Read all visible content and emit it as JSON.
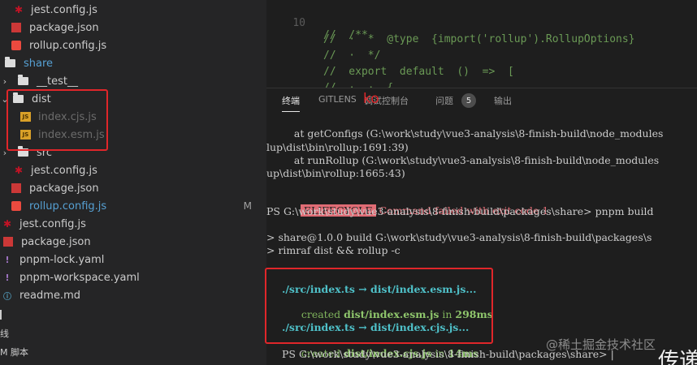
{
  "explorer": {
    "items": [
      {
        "label": "jest.config.js",
        "icon": "jest"
      },
      {
        "label": "package.json",
        "icon": "npm"
      },
      {
        "label": "rollup.config.js",
        "icon": "rollup"
      },
      {
        "label": "share",
        "icon": "folder"
      },
      {
        "label": "__test__",
        "icon": "folder"
      },
      {
        "label": "dist",
        "icon": "folder"
      },
      {
        "label": "index.cjs.js",
        "icon": "js"
      },
      {
        "label": "index.esm.js",
        "icon": "js"
      },
      {
        "label": "src",
        "icon": "folder"
      },
      {
        "label": "jest.config.js",
        "icon": "jest"
      },
      {
        "label": "package.json",
        "icon": "npm"
      },
      {
        "label": "rollup.config.js",
        "icon": "rollup",
        "badge": "M"
      },
      {
        "label": "jest.config.js",
        "icon": "jest"
      },
      {
        "label": "package.json",
        "icon": "npm"
      },
      {
        "label": "pnpm-lock.yaml",
        "icon": "yaml"
      },
      {
        "label": "pnpm-workspace.yaml",
        "icon": "yaml"
      },
      {
        "label": "readme.md",
        "icon": "md"
      }
    ],
    "outline_label": "线",
    "scripts_label": "M 脚本"
  },
  "editor": {
    "line_number": "10",
    "lines": [
      "//  /**",
      "//  ·  *  @type  {import('rollup').RollupOptions}",
      "//  ·  */",
      "//  export  default  ()  =>  [",
      "//  ·  ·  {"
    ]
  },
  "panel": {
    "tabs": [
      "终端",
      "GITLENS",
      "调试控制台",
      "问题",
      "输出"
    ],
    "problems_count": "5",
    "overlay_text": "ko"
  },
  "terminal": {
    "lines": [
      "    at getConfigs (G:\\work\\study\\vue3-analysis\\8-finish-build\\node_modules",
      "lup\\dist\\bin\\rollup:1691:39)",
      "    at runRollup (G:\\work\\study\\vue3-analysis\\8-finish-build\\node_modules",
      "up\\dist\\bin\\rollup:1665:43)",
      "ELIFECYCLE",
      " Command failed with exit code 1.",
      "PS G:\\work\\study\\vue3-analysis\\8-finish-build\\packages\\share> pnpm build",
      "> share@1.0.0 build G:\\work\\study\\vue3-analysis\\8-finish-build\\packages\\s",
      "> rimraf dist && rollup -c",
      "./src/index.ts → dist/index.esm.js...",
      "created ",
      "dist/index.esm.js",
      " in ",
      "298ms",
      "./src/index.ts → dist/index.cjs.js...",
      "created ",
      "dist/index.cjs.js",
      " in ",
      "14ms",
      "PS G:\\work\\study\\vue3-analysis\\8-finish-build\\packages\\share> |"
    ]
  },
  "watermark": "@稀土掘金技术社区",
  "corner_text": "传递"
}
